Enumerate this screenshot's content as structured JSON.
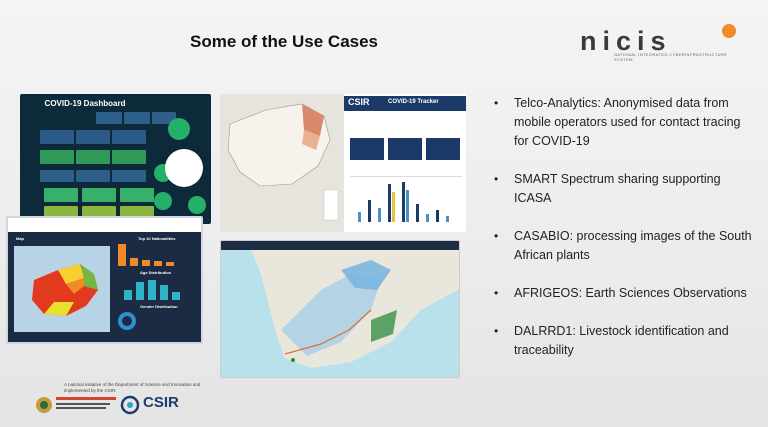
{
  "slide": {
    "title": "Some of the Use Cases"
  },
  "logo": {
    "wordmark": "nicis",
    "subtitle": "NATIONAL INTEGRATED CYBERINFRASTRUCTURE SYSTEM",
    "accent_color": "#f08a2b"
  },
  "screenshots": {
    "dashboard_title": "COVID-19 Dashboard",
    "tracker_brand": "CSIR",
    "tracker_title": "COVID-19 Tracker",
    "map_panel_label": "Map",
    "panel_nationalities": "Top 10 Nationalities",
    "panel_age": "Age Distribution",
    "panel_gender": "Gender Distribution"
  },
  "bullets": [
    "Telco-Analytics: Anonymised data from mobile operators used for contact tracing for COVID-19",
    "SMART Spectrum sharing supporting ICASA",
    "CASABIO: processing images of the South African plants",
    "AFRIGEOS: Earth Sciences Observations",
    "DALRRD1: Livestock identification and traceability"
  ],
  "footer": {
    "initiative_text": "A national initiative of the Department of Science and Innovation and implemented by the CSIR.",
    "dsi_label": "science & innovation",
    "csir_label": "CSIR"
  }
}
